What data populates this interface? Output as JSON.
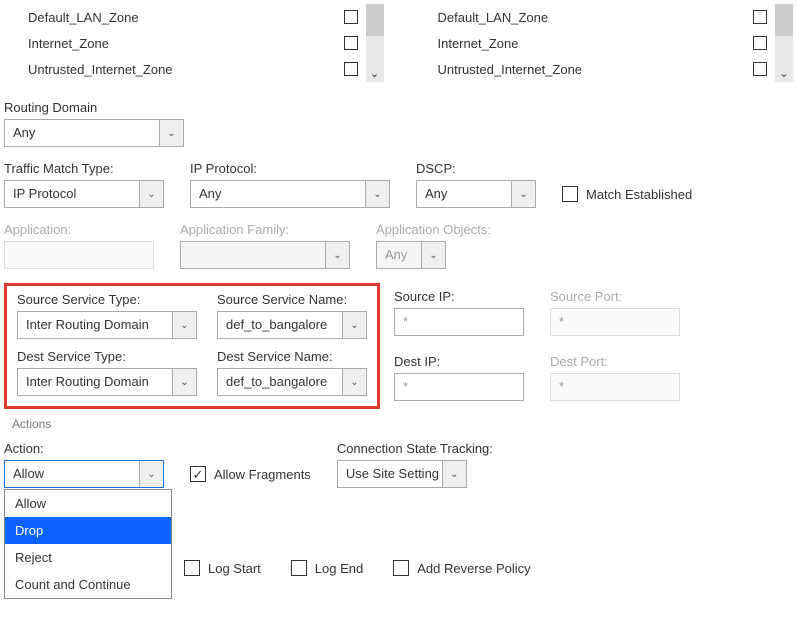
{
  "zones_left": [
    "Default_LAN_Zone",
    "Internet_Zone",
    "Untrusted_Internet_Zone"
  ],
  "zones_right": [
    "Default_LAN_Zone",
    "Internet_Zone",
    "Untrusted_Internet_Zone"
  ],
  "routing_domain": {
    "label": "Routing Domain",
    "value": "Any"
  },
  "traffic_match": {
    "label": "Traffic Match Type:",
    "value": "IP Protocol"
  },
  "ip_protocol": {
    "label": "IP Protocol:",
    "value": "Any"
  },
  "dscp": {
    "label": "DSCP:",
    "value": "Any"
  },
  "match_established": "Match Established",
  "application": {
    "label": "Application:",
    "value": ""
  },
  "app_family": {
    "label": "Application Family:",
    "value": ""
  },
  "app_objects": {
    "label": "Application Objects:",
    "value": "Any"
  },
  "src_svc_type": {
    "label": "Source Service Type:",
    "value": "Inter Routing Domain"
  },
  "src_svc_name": {
    "label": "Source Service Name:",
    "value": "def_to_bangalore"
  },
  "source_ip": {
    "label": "Source IP:",
    "value": "*"
  },
  "source_port": {
    "label": "Source Port:",
    "value": "*"
  },
  "dst_svc_type": {
    "label": "Dest Service Type:",
    "value": "Inter Routing Domain"
  },
  "dst_svc_name": {
    "label": "Dest Service Name:",
    "value": "def_to_bangalore"
  },
  "dest_ip": {
    "label": "Dest IP:",
    "value": "*"
  },
  "dest_port": {
    "label": "Dest Port:",
    "value": "*"
  },
  "actions_section": "Actions",
  "action": {
    "label": "Action:",
    "value": "Allow",
    "options": [
      "Allow",
      "Drop",
      "Reject",
      "Count and Continue"
    ]
  },
  "allow_fragments": "Allow Fragments",
  "conn_state": {
    "label": "Connection State Tracking:",
    "value": "Use Site Setting"
  },
  "log_start": "Log Start",
  "log_end": "Log End",
  "add_reverse": "Add Reverse Policy"
}
